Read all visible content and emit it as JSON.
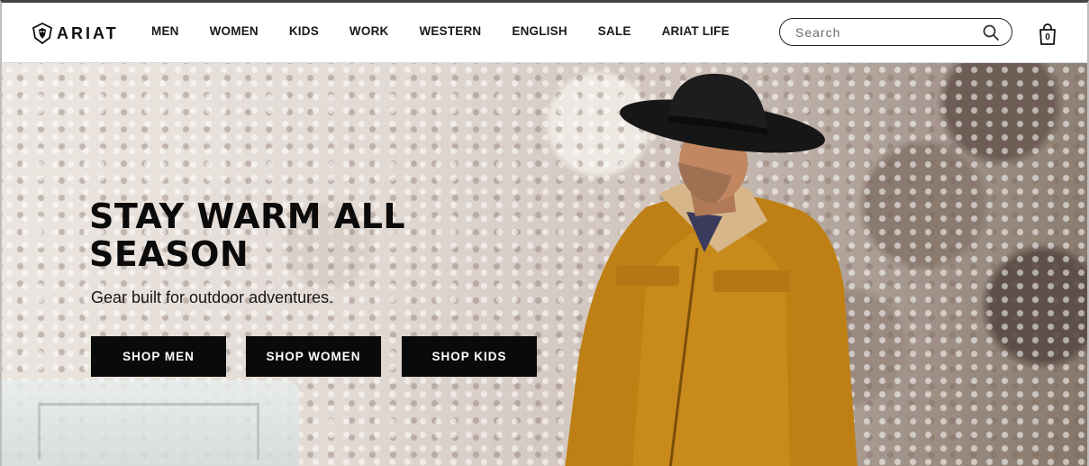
{
  "brand": {
    "logo_text": "ARIAT"
  },
  "nav": {
    "items": [
      {
        "label": "MEN"
      },
      {
        "label": "WOMEN"
      },
      {
        "label": "KIDS"
      },
      {
        "label": "WORK"
      },
      {
        "label": "WESTERN"
      },
      {
        "label": "ENGLISH"
      },
      {
        "label": "SALE"
      },
      {
        "label": "ARIAT LIFE"
      }
    ]
  },
  "search": {
    "placeholder": "Search",
    "icon": "search-icon"
  },
  "cart": {
    "count": "0",
    "icon": "shopping-bag-icon"
  },
  "hero": {
    "headline": "STAY WARM ALL SEASON",
    "subhead": "Gear built for outdoor adventures.",
    "buttons": [
      {
        "label": "SHOP MEN"
      },
      {
        "label": "SHOP WOMEN"
      },
      {
        "label": "SHOP KIDS"
      }
    ]
  },
  "colors": {
    "button_bg": "#0a0a0a",
    "button_text": "#ffffff",
    "text": "#0b0b0b"
  }
}
